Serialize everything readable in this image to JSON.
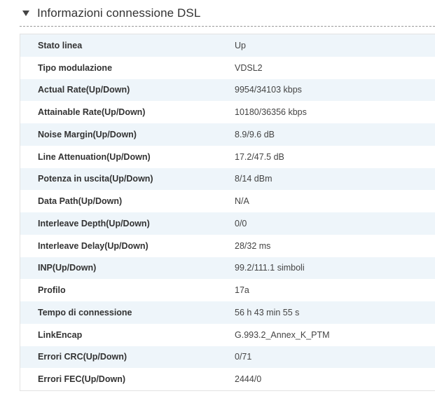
{
  "section": {
    "title": "Informazioni connessione DSL",
    "expand_icon": "triangle-down-icon"
  },
  "rows": [
    {
      "label": "Stato linea",
      "value": "Up"
    },
    {
      "label": "Tipo modulazione",
      "value": "VDSL2"
    },
    {
      "label": "Actual Rate(Up/Down)",
      "value": "9954/34103 kbps"
    },
    {
      "label": "Attainable Rate(Up/Down)",
      "value": "10180/36356 kbps"
    },
    {
      "label": "Noise Margin(Up/Down)",
      "value": "8.9/9.6 dB"
    },
    {
      "label": "Line Attenuation(Up/Down)",
      "value": "17.2/47.5 dB"
    },
    {
      "label": "Potenza in uscita(Up/Down)",
      "value": "8/14 dBm"
    },
    {
      "label": "Data Path(Up/Down)",
      "value": "N/A"
    },
    {
      "label": "Interleave Depth(Up/Down)",
      "value": "0/0"
    },
    {
      "label": "Interleave Delay(Up/Down)",
      "value": "28/32 ms"
    },
    {
      "label": "INP(Up/Down)",
      "value": "99.2/111.1 simboli"
    },
    {
      "label": "Profilo",
      "value": "17a"
    },
    {
      "label": "Tempo di connessione",
      "value": "56 h 43 min 55 s"
    },
    {
      "label": "LinkEncap",
      "value": "G.993.2_Annex_K_PTM"
    },
    {
      "label": "Errori CRC(Up/Down)",
      "value": "0/71"
    },
    {
      "label": "Errori FEC(Up/Down)",
      "value": "2444/0"
    }
  ],
  "colors": {
    "row_alt": "#eef5fa",
    "row_plain": "#ffffff",
    "text": "#333333"
  }
}
